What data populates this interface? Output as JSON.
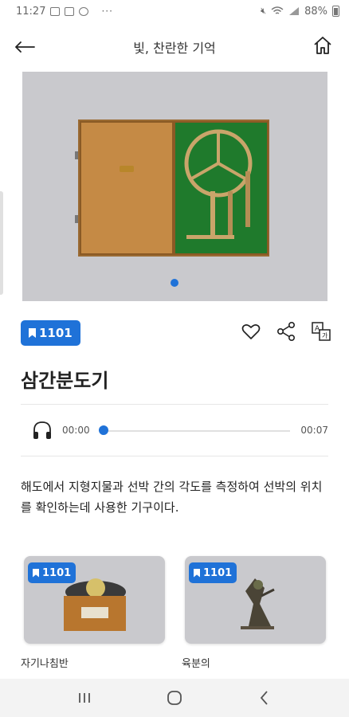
{
  "status_bar": {
    "time": "11:27",
    "more": "···",
    "battery": "88%"
  },
  "header": {
    "title": "빛, 찬란한 기억"
  },
  "hero": {
    "image_name": "sextant in wooden case"
  },
  "exhibit": {
    "badge": "1101",
    "title": "삼간분도기",
    "description": "해도에서 지형지물과 선박 간의 각도를 측정하여 선박의 위치를 확인하는데 사용한 기구이다."
  },
  "audio": {
    "current_time": "00:00",
    "total_time": "00:07",
    "progress": 0
  },
  "related": [
    {
      "badge": "1101",
      "name": "자기나침반"
    },
    {
      "badge": "1101",
      "name": "육분의"
    }
  ],
  "colors": {
    "accent": "#1f72d8",
    "image_bg": "#c9c9cd"
  }
}
